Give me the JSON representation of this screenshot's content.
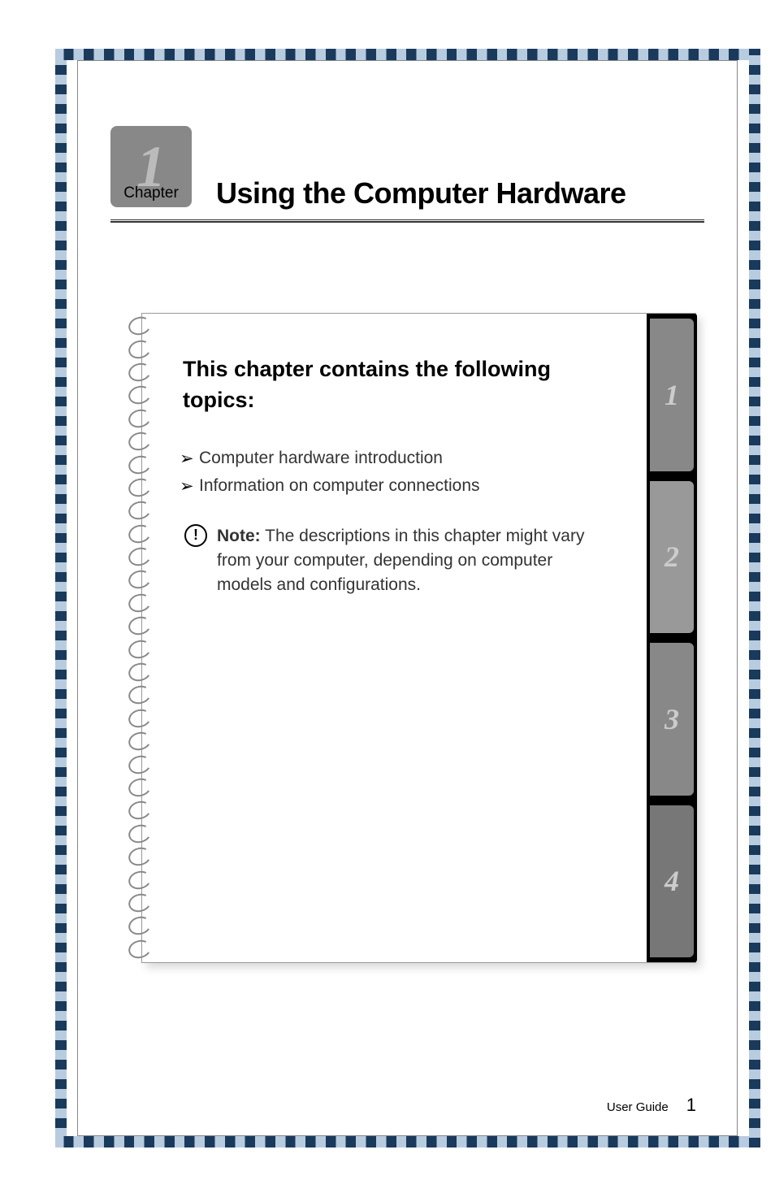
{
  "chapter": {
    "number": "1",
    "label": "Chapter",
    "title": "Using the Computer Hardware"
  },
  "card": {
    "heading": "This chapter contains the following topics:",
    "topics": [
      "Computer hardware introduction",
      "Information on computer connections"
    ],
    "note": {
      "label": "Note:",
      "text": " The descriptions in this chapter might vary from your computer, depending on computer models and configurations."
    }
  },
  "tabs": [
    "1",
    "2",
    "3",
    "4"
  ],
  "footer": {
    "label": "User Guide",
    "page": "1"
  }
}
